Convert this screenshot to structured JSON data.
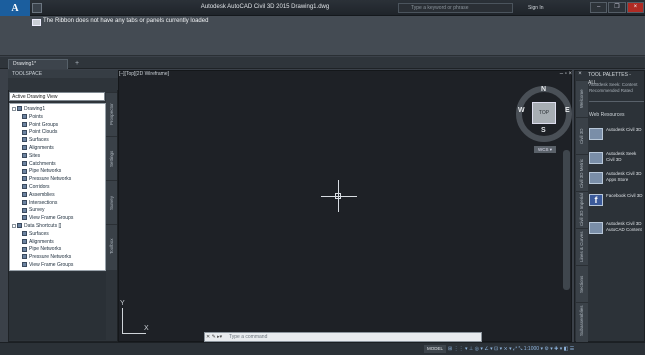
{
  "titlebar": {
    "title": "Autodesk AutoCAD Civil 3D 2015   Drawing1.dwg",
    "search_placeholder": "Type a keyword or phrase",
    "signin_label": "Sign In",
    "minimize": "–",
    "restore": "❐",
    "close": "×"
  },
  "ribbon": {
    "message": "The Ribbon does not have any tabs or panels currently loaded"
  },
  "doc_tabs": {
    "active": "Drawing1*",
    "add": "+"
  },
  "toolspace": {
    "title": "TOOLSPACE",
    "view_combo": "Active Drawing View",
    "tree": [
      {
        "label": "Drawing1",
        "indent": 0
      },
      {
        "label": "Points",
        "indent": 1
      },
      {
        "label": "Point Groups",
        "indent": 1
      },
      {
        "label": "Point Clouds",
        "indent": 1
      },
      {
        "label": "Surfaces",
        "indent": 1
      },
      {
        "label": "Alignments",
        "indent": 1
      },
      {
        "label": "Sites",
        "indent": 1
      },
      {
        "label": "Catchments",
        "indent": 1
      },
      {
        "label": "Pipe Networks",
        "indent": 1
      },
      {
        "label": "Pressure Networks",
        "indent": 1
      },
      {
        "label": "Corridors",
        "indent": 1
      },
      {
        "label": "Assemblies",
        "indent": 1
      },
      {
        "label": "Intersections",
        "indent": 1
      },
      {
        "label": "Survey",
        "indent": 1
      },
      {
        "label": "View Frame Groups",
        "indent": 1
      },
      {
        "label": "Data Shortcuts []",
        "indent": 0
      },
      {
        "label": "Surfaces",
        "indent": 1
      },
      {
        "label": "Alignments",
        "indent": 1
      },
      {
        "label": "Pipe Networks",
        "indent": 1
      },
      {
        "label": "Pressure Networks",
        "indent": 1
      },
      {
        "label": "View Frame Groups",
        "indent": 1
      }
    ],
    "side_tabs": [
      "Prospector",
      "Settings",
      "Survey",
      "Toolbox"
    ]
  },
  "viewport": {
    "label": "[–][Top][2D Wireframe]",
    "controls": "– ▫ ×",
    "viewcube_face": "TOP",
    "compass": {
      "n": "N",
      "s": "S",
      "e": "E",
      "w": "W"
    },
    "wcs": "WCS ▾",
    "ucs_x": "X",
    "ucs_y": "Y"
  },
  "command_line": {
    "placeholder": "Type a command",
    "icons": "✕ ✎ ▸▾"
  },
  "statusbar": {
    "model": "MODEL",
    "icons": "⊞ ⋮⋮ ▾ ⊥ ◎ ▾ ∠ ▾ ⊡ ▾ ⨯ ▾ ⤢ ⤡ 1:1000 ▾ ⚙ ▾ ✚ ▾ ◧ ☰"
  },
  "palette": {
    "title": "TOOL PALETTES - ALL...",
    "close": "×",
    "message": "Autodesk Seek: Content Recommended Rated",
    "section_title": "Web Resources",
    "items": [
      {
        "label": "Autodesk Civil 3D",
        "kind": "thumb"
      },
      {
        "label": "Autodesk Seek Civil 3D",
        "kind": "thumb"
      },
      {
        "label": "Autodesk Civil 3D Apps Store",
        "kind": "thumb"
      },
      {
        "label": "Facebook Civil 3D",
        "kind": "facebook"
      },
      {
        "label": "Autodesk Civil 3D AutoCAD Content",
        "kind": "thumb"
      }
    ],
    "side_tabs": [
      "Welcome",
      "Civil 3D",
      "Civil 3D Metric",
      "Civil 3D Imperial",
      "Lines & Curves",
      "Sections",
      "Subassemblies"
    ]
  },
  "colors": {
    "accent": "#1b5e9e",
    "canvas_bg": "#1e2126",
    "panel_bg": "#2e343a",
    "close_button": "#b02b24"
  }
}
